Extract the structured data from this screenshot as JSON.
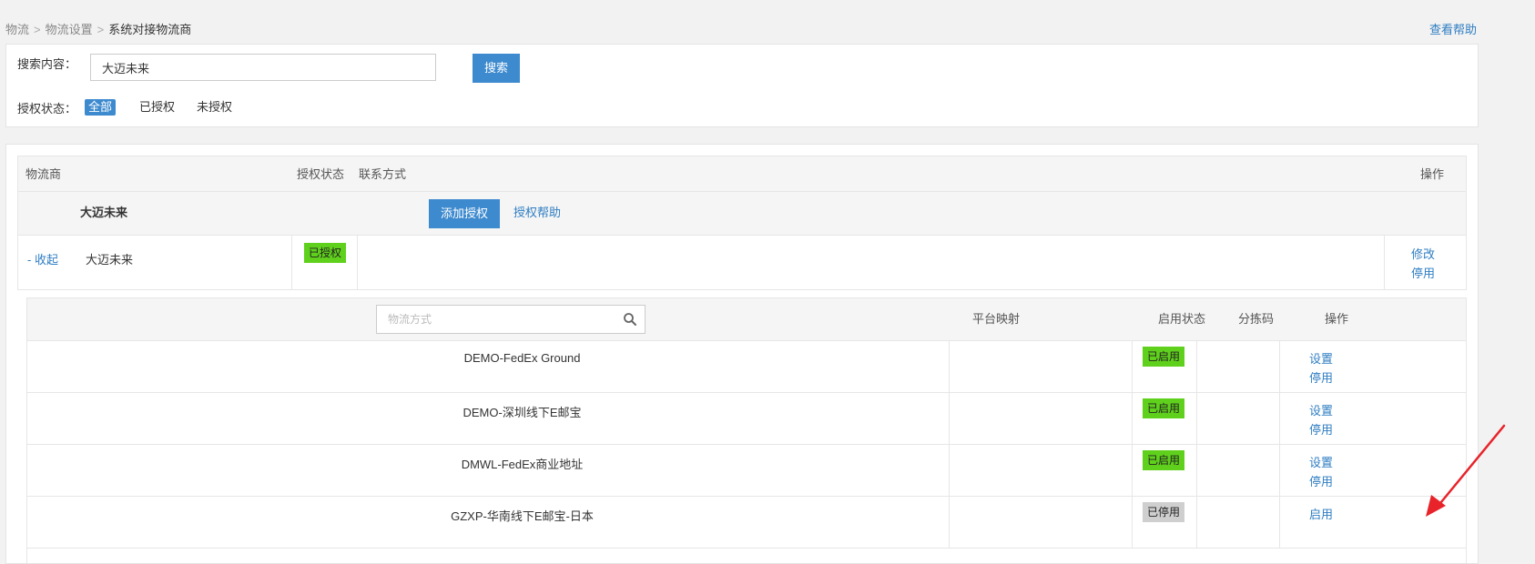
{
  "breadcrumb": {
    "item1": "物流",
    "item2": "物流设置",
    "current": "系统对接物流商",
    "sep": ">"
  },
  "help_link": "查看帮助",
  "search": {
    "label": "搜索内容：",
    "value": "大迈未来",
    "button": "搜索"
  },
  "auth_filter": {
    "label": "授权状态：",
    "options": [
      "全部",
      "已授权",
      "未授权"
    ],
    "active": "全部"
  },
  "table": {
    "headers": {
      "provider": "物流商",
      "auth_status": "授权状态",
      "contact": "联系方式",
      "action": "操作"
    },
    "provider": {
      "name": "大迈未来",
      "add_auth_button": "添加授权",
      "auth_help": "授权帮助",
      "account": {
        "collapse": "- 收起",
        "name": "大迈未来",
        "status": "已授权",
        "actions": {
          "edit": "修改",
          "disable": "停用"
        }
      }
    }
  },
  "methods": {
    "search_placeholder": "物流方式",
    "headers": {
      "mapping": "平台映射",
      "status": "启用状态",
      "sort_code": "分拣码",
      "action": "操作"
    },
    "rows": [
      {
        "name": "DEMO-FedEx Ground",
        "status": "已启用",
        "action1": "设置",
        "action2": "停用"
      },
      {
        "name": "DEMO-深圳线下E邮宝",
        "status": "已启用",
        "action1": "设置",
        "action2": "停用"
      },
      {
        "name": "DMWL-FedEx商业地址",
        "status": "已启用",
        "action1": "设置",
        "action2": "停用"
      },
      {
        "name": "GZXP-华南线下E邮宝-日本",
        "status": "已停用",
        "action1": "启用"
      }
    ]
  },
  "colors": {
    "primary": "#3d8acf",
    "link": "#2f7ec2",
    "enabled": "#5fd11c",
    "disabled": "#cfcfcf",
    "arrow": "#e8232a"
  }
}
